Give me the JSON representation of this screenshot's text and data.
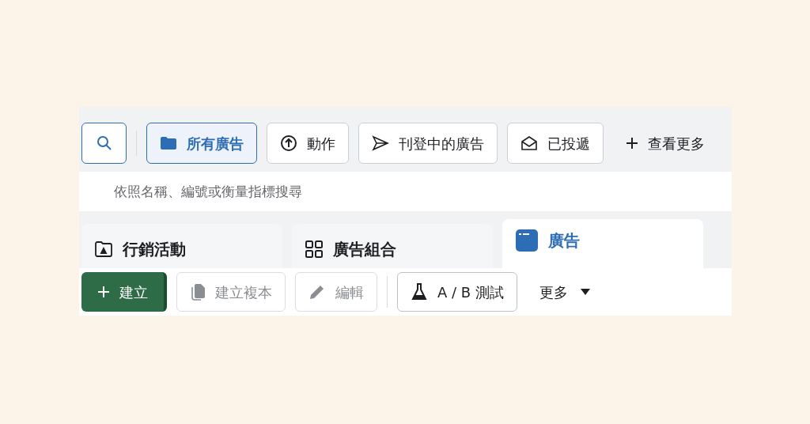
{
  "filters": [
    {
      "label": "所有廣告",
      "selected": true
    },
    {
      "label": "動作",
      "selected": false
    },
    {
      "label": "刊登中的廣告",
      "selected": false
    },
    {
      "label": "已投遞",
      "selected": false
    }
  ],
  "see_more": "查看更多",
  "search": {
    "placeholder": "依照名稱、編號或衡量指標搜尋"
  },
  "tabs": [
    {
      "label": "行銷活動",
      "selected": false
    },
    {
      "label": "廣告組合",
      "selected": false
    },
    {
      "label": "廣告",
      "selected": true
    }
  ],
  "toolbar": [
    {
      "label": "建立",
      "kind": "primary",
      "disabled": false
    },
    {
      "label": "建立複本",
      "kind": "plain",
      "disabled": true
    },
    {
      "label": "編輯",
      "kind": "plain",
      "disabled": true
    },
    {
      "label": "A / B 測試",
      "kind": "plain",
      "disabled": false
    },
    {
      "label": "更多",
      "kind": "dropdown",
      "disabled": false
    }
  ]
}
